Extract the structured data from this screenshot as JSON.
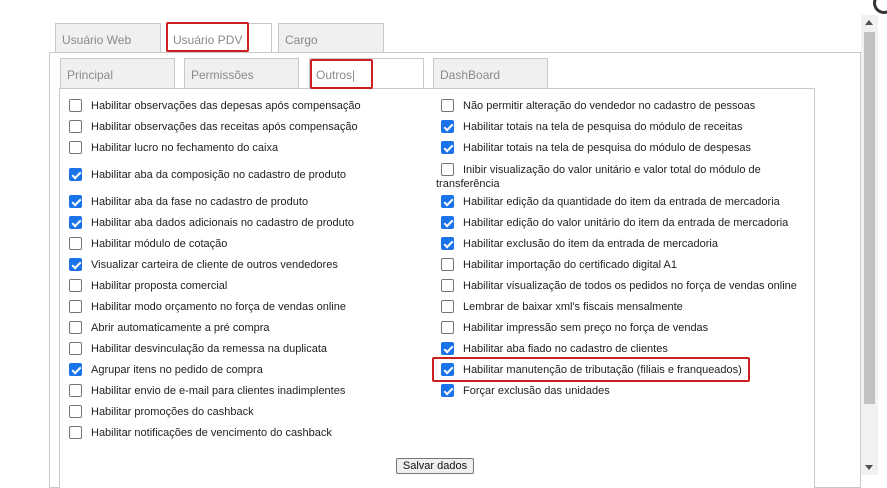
{
  "outer_tabs": [
    {
      "label": "Usuário Web"
    },
    {
      "label": "Usuário PDV"
    },
    {
      "label": "Cargo"
    }
  ],
  "inner_tabs": [
    {
      "label": "Principal"
    },
    {
      "label": "Permissões"
    },
    {
      "label": "Outros|"
    },
    {
      "label": "DashBoard"
    }
  ],
  "left_options": [
    {
      "label": "Habilitar observações das depesas após compensação",
      "checked": false
    },
    {
      "label": "Habilitar observações das receitas após compensação",
      "checked": false
    },
    {
      "label": "Habilitar lucro no fechamento do caixa",
      "checked": false
    },
    {
      "label": "Habilitar aba da composição no cadastro de produto",
      "checked": true
    },
    {
      "label": "Habilitar aba da fase no cadastro de produto",
      "checked": true
    },
    {
      "label": "Habilitar aba dados adicionais no cadastro de produto",
      "checked": true
    },
    {
      "label": "Habilitar módulo de cotação",
      "checked": false
    },
    {
      "label": "Visualizar carteira de cliente de outros vendedores",
      "checked": true
    },
    {
      "label": "Habilitar proposta comercial",
      "checked": false
    },
    {
      "label": "Habilitar modo orçamento no força de vendas online",
      "checked": false
    },
    {
      "label": "Abrir automaticamente a pré compra",
      "checked": false
    },
    {
      "label": "Habilitar desvinculação da remessa na duplicata",
      "checked": false
    },
    {
      "label": "Agrupar itens no pedido de compra",
      "checked": true
    },
    {
      "label": "Habilitar envio de e-mail para clientes inadimplentes",
      "checked": false
    },
    {
      "label": "Habilitar promoções do cashback",
      "checked": false
    },
    {
      "label": "Habilitar notificações de vencimento do cashback",
      "checked": false
    }
  ],
  "right_options": [
    {
      "label": "Não permitir alteração do vendedor no cadastro de pessoas",
      "checked": false
    },
    {
      "label": "Habilitar totais na tela de pesquisa do módulo de receitas",
      "checked": true
    },
    {
      "label": "Habilitar totais na tela de pesquisa do módulo de despesas",
      "checked": true
    },
    {
      "label": "Inibir visualização do valor unitário e valor total do módulo de",
      "label_cont": "transferência",
      "checked": false
    },
    {
      "label": "Habilitar edição da quantidade do item da entrada de mercadoria",
      "checked": true
    },
    {
      "label": "Habilitar edição do valor unitário do item da entrada de mercadoria",
      "checked": true
    },
    {
      "label": "Habilitar exclusão do item da entrada de mercadoria",
      "checked": true
    },
    {
      "label": "Habilitar importação do certificado digital A1",
      "checked": false
    },
    {
      "label": "Habilitar visualização de todos os pedidos no força de vendas online",
      "checked": false
    },
    {
      "label": "Lembrar de baixar xml's fiscais mensalmente",
      "checked": false
    },
    {
      "label": "Habilitar impressão sem preço no força de vendas",
      "checked": false
    },
    {
      "label": "Habilitar aba fiado no cadastro de clientes",
      "checked": true
    },
    {
      "label": "Habilitar manutenção de tributação (filiais e franqueados)",
      "checked": true
    },
    {
      "label": "Forçar exclusão das unidades",
      "checked": true
    }
  ],
  "save_button": {
    "label": "Salvar dados"
  },
  "colors": {
    "accent": "#1a73e8",
    "highlight": "#cc1f1f"
  }
}
